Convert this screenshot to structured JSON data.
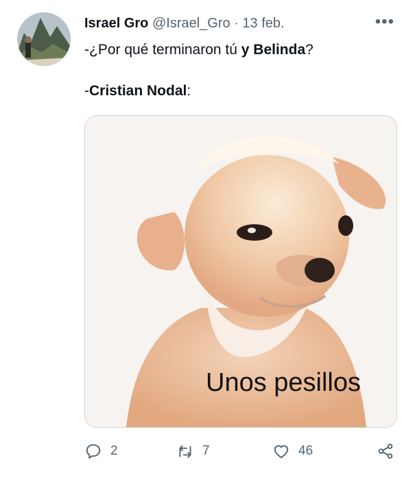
{
  "tweet": {
    "author_name": "Israel Gro",
    "handle": "@Israel_Gro",
    "separator": "·",
    "date": "13 feb.",
    "more_label": "•••",
    "line1_prefix": "-¿Por qué terminaron tú ",
    "line1_bold": "y Belinda",
    "line1_suffix": "?",
    "line2_prefix": "-",
    "line2_bold": "Cristian Nodal",
    "line2_suffix": ":",
    "image_caption": "Unos pesillos"
  },
  "actions": {
    "reply_count": "2",
    "retweet_count": "7",
    "like_count": "46"
  },
  "icons": {
    "reply": "reply-icon",
    "retweet": "retweet-icon",
    "like": "heart-icon",
    "share": "share-icon",
    "more": "more-icon"
  },
  "colors": {
    "text": "#0f1419",
    "secondary": "#536471",
    "border": "#cfd9de"
  }
}
